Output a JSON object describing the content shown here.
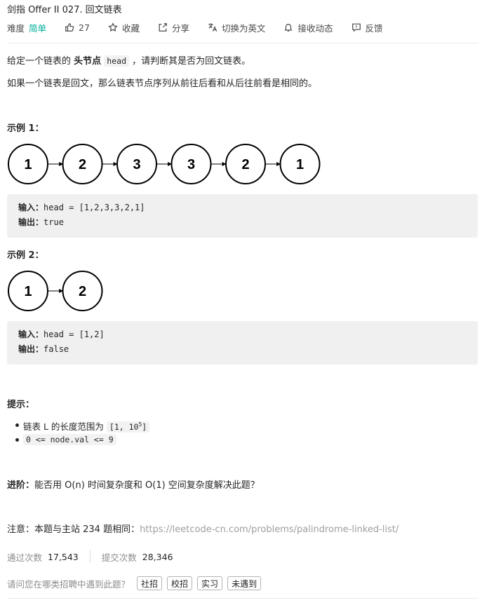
{
  "problem": {
    "title": "剑指 Offer II 027. 回文链表",
    "difficulty_label": "难度",
    "difficulty_value": "简单",
    "likes": "27",
    "actions": {
      "favorite": "收藏",
      "share": "分享",
      "switch_lang": "切换为英文",
      "subscribe": "接收动态",
      "feedback": "反馈"
    }
  },
  "description": {
    "p1_pre": "给定一个链表的 ",
    "p1_bold": "头节点",
    "p1_code": "head",
    "p1_post": " ，请判断其是否为回文链表。",
    "p2": "如果一个链表是回文，那么链表节点序列从前往后看和从后往前看是相同的。"
  },
  "example1": {
    "heading": "示例 1：",
    "nodes": [
      "1",
      "2",
      "3",
      "3",
      "2",
      "1"
    ],
    "input_label": "输入：",
    "input_value": "head = [1,2,3,3,2,1]",
    "output_label": "输出：",
    "output_value": "true"
  },
  "example2": {
    "heading": "示例 2：",
    "nodes": [
      "1",
      "2"
    ],
    "input_label": "输入：",
    "input_value": "head = [1,2]",
    "output_label": "输出：",
    "output_value": "false"
  },
  "hints": {
    "heading": "提示：",
    "item1_text": "链表 L 的长度范围为 ",
    "item1_code_pre": "[1, 10",
    "item1_code_sup": "5",
    "item1_code_post": "]",
    "item2_code": "0 <= node.val <= 9"
  },
  "advanced": {
    "label": "进阶：",
    "text": "能否用 O(n) 时间复杂度和 O(1) 空间复杂度解决此题？"
  },
  "note": {
    "text": "注意：本题与主站 234 题相同：",
    "link": "https://leetcode-cn.com/problems/palindrome-linked-list/"
  },
  "stats": {
    "accepted_label": "通过次数",
    "accepted_value": "17,543",
    "submitted_label": "提交次数",
    "submitted_value": "28,346"
  },
  "survey": {
    "question": "请问您在哪类招聘中遇到此题？",
    "options": [
      "社招",
      "校招",
      "实习",
      "未遇到"
    ]
  }
}
